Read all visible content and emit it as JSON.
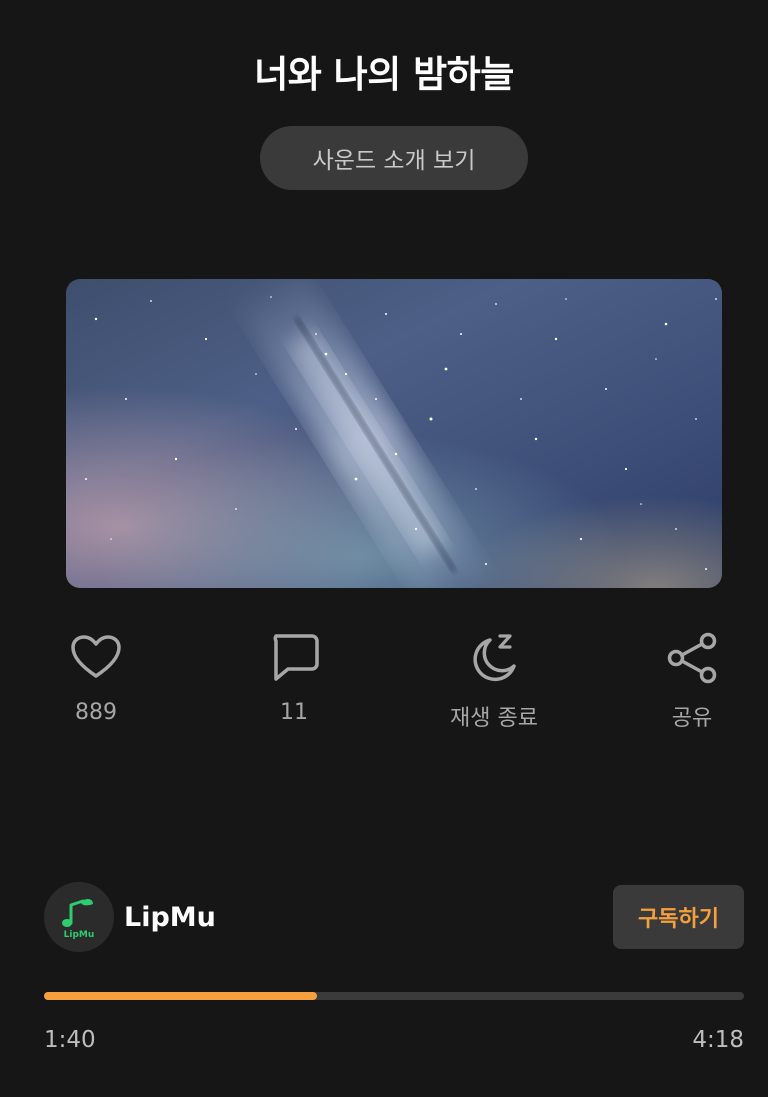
{
  "track": {
    "title": "너와 나의 밤하늘",
    "intro_button_label": "사운드 소개 보기"
  },
  "cover": {
    "icon": "milky-way-night-sky-image"
  },
  "actions": [
    {
      "name": "like",
      "icon": "heart-icon",
      "label": "889"
    },
    {
      "name": "comment",
      "icon": "comment-icon",
      "label": "11"
    },
    {
      "name": "sleep-timer",
      "icon": "moon-sleep-icon",
      "label": "재생 종료"
    },
    {
      "name": "share",
      "icon": "share-icon",
      "label": "공유"
    }
  ],
  "channel": {
    "name": "LipMu",
    "avatar_icon": "lipmu-music-note-logo",
    "subscribe_label": "구독하기"
  },
  "player": {
    "elapsed": "1:40",
    "total": "4:18",
    "progress_percent": 39
  },
  "colors": {
    "accent": "#f5a03d",
    "background": "#161616",
    "button_bg": "#3a3a3a",
    "logo_green": "#2ecc71"
  }
}
